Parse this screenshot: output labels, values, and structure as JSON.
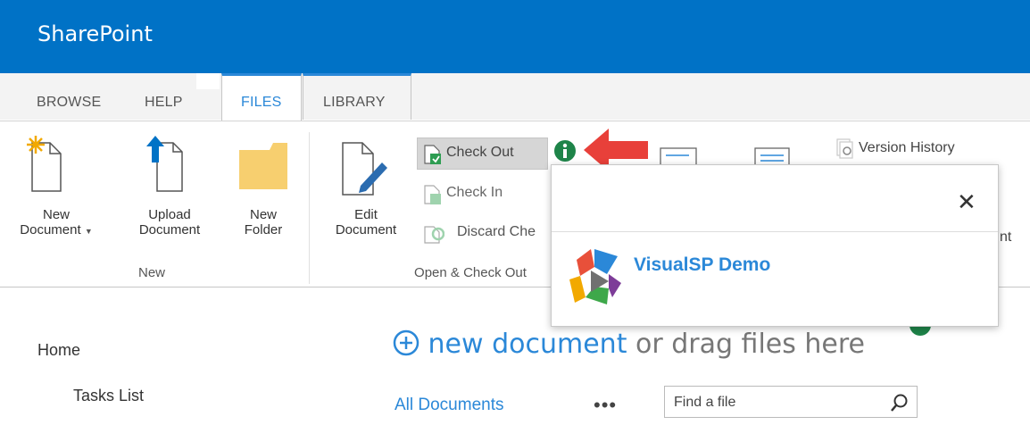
{
  "suite": {
    "brand": "SharePoint"
  },
  "tabs": [
    {
      "label": "BROWSE"
    },
    {
      "label": "HELP"
    },
    {
      "label": "FILES"
    },
    {
      "label": "LIBRARY"
    }
  ],
  "ribbon": {
    "new_group": {
      "name": "New",
      "new_document_line1": "New",
      "new_document_line2": "Document",
      "upload_line1": "Upload",
      "upload_line2": "Document",
      "new_folder_line1": "New",
      "new_folder_line2": "Folder"
    },
    "open_group": {
      "name": "Open & Check Out",
      "edit_line1": "Edit",
      "edit_line2": "Document",
      "check_out": "Check Out",
      "check_in": "Check In",
      "discard": "Discard Che"
    },
    "version_history": "Version History",
    "trailing_text": "nt"
  },
  "popup": {
    "close_glyph": "✕",
    "title": "VisualSP Demo"
  },
  "nav": {
    "home": "Home",
    "tasks": "Tasks List"
  },
  "main": {
    "new_document": "new document",
    "drag_text": " or drag files here",
    "view_all": "All Documents",
    "ellipsis": "•••",
    "search_placeholder": "Find a file"
  },
  "colors": {
    "suite_bar": "#0072c6",
    "accent": "#2b88d8",
    "info_green": "#1e8449",
    "arrow_red": "#e8403a"
  }
}
